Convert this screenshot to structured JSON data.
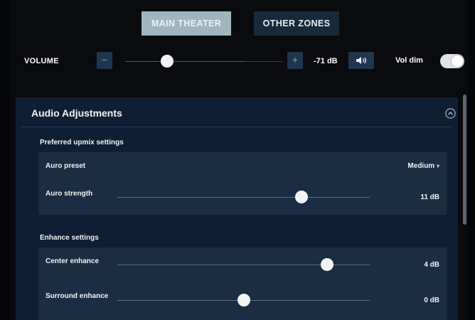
{
  "tabs": {
    "main_theater": "MAIN THEATER",
    "other_zones": "OTHER ZONES"
  },
  "volume": {
    "label": "VOLUME",
    "minus": "−",
    "plus": "+",
    "value": "-71 dB",
    "level_fraction": 0.27,
    "vol_dim_label": "Vol dim",
    "vol_dim_on": true
  },
  "audio": {
    "title": "Audio Adjustments",
    "upmix": {
      "section_label": "Preferred upmix settings",
      "auro_preset_label": "Auro preset",
      "auro_preset_value": "Medium",
      "auro_strength_label": "Auro strength",
      "auro_strength_value": "11 dB",
      "auro_strength_fraction": 0.73
    },
    "enhance": {
      "section_label": "Enhance settings",
      "center_label": "Center enhance",
      "center_value": "4 dB",
      "center_fraction": 0.83,
      "surround_label": "Surround enhance",
      "surround_value": "0 dB",
      "surround_fraction": 0.5
    }
  },
  "icons": {
    "speaker": "speaker-icon",
    "collapse": "chevron-up-circle-icon",
    "dropdown": "caret-down-icon"
  },
  "colors": {
    "accent_button": "#1f3550",
    "active_tab": "#9fb6bf",
    "panel": "#0f1f33",
    "card": "#1a2d43"
  }
}
